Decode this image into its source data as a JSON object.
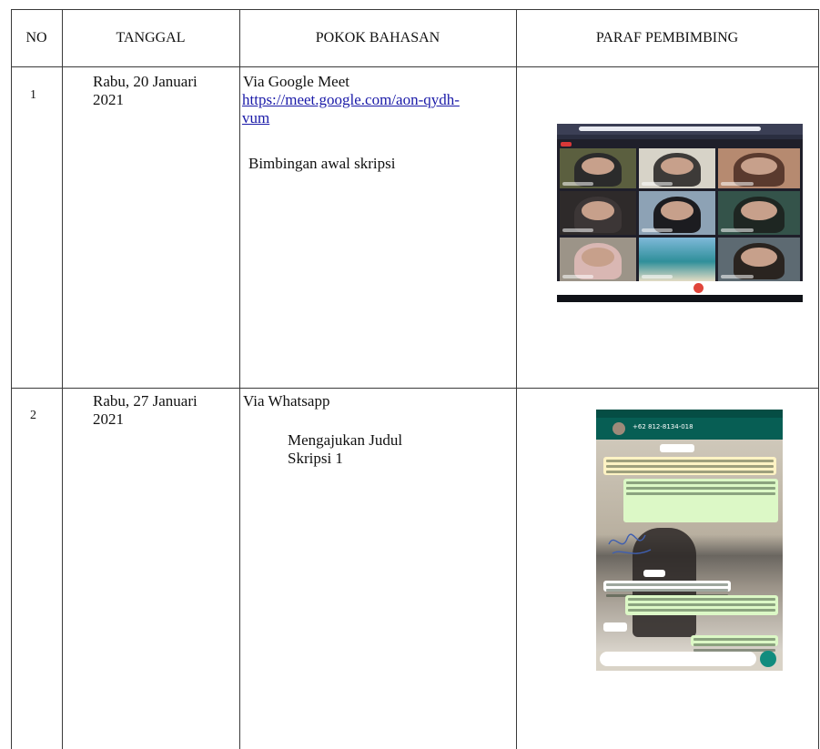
{
  "table": {
    "headers": {
      "no": "NO",
      "tanggal": "TANGGAL",
      "pokok_bahasan": "POKOK BAHASAN",
      "paraf_pembimbing": "PARAF PEMBIMBING"
    },
    "rows": [
      {
        "no": "1",
        "tanggal_line1": "Rabu, 20 Januari",
        "tanggal_line2": "2021",
        "pokok_title": "Via Google Meet",
        "pokok_link_line1": "https://meet.google.com/aon-qydh-",
        "pokok_link_line2": "vum",
        "pokok_desc": "Bimbingan awal skripsi",
        "paraf": "google-meet-screenshot"
      },
      {
        "no": "2",
        "tanggal_line1": "Rabu, 27 Januari",
        "tanggal_line2": "2021",
        "pokok_title": "Via Whatsapp",
        "pokok_desc_line1": "Mengajukan Judul",
        "pokok_desc_line2": "Skripsi 1",
        "paraf": "whatsapp-chat-screenshot"
      }
    ]
  },
  "colors": {
    "link": "#1a1aa8",
    "rule": "#3a3a3a",
    "whatsapp_header": "#075e54",
    "meet_end_call": "#e0453a"
  },
  "whatsapp": {
    "phone": "+62 812-8134-018"
  }
}
